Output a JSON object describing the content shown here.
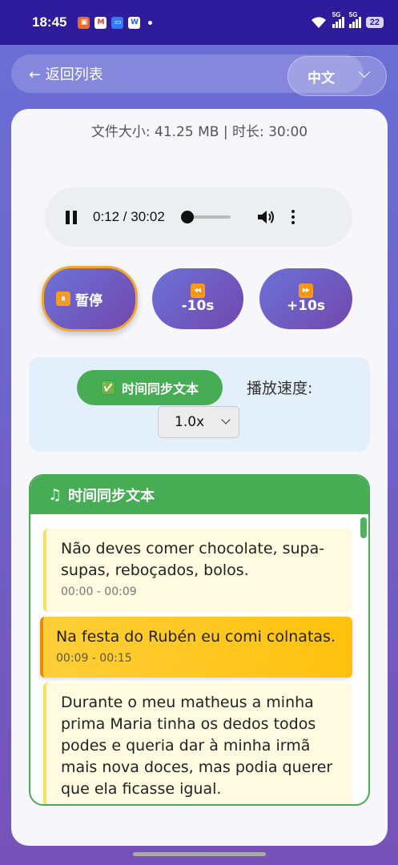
{
  "status": {
    "time": "18:45",
    "battery": "22",
    "net1": "5G",
    "net2": "5G"
  },
  "header": {
    "back_label": "← 返回列表",
    "language": "中文"
  },
  "file_info": "文件大小: 41.25 MB | 时长: 30:00",
  "player": {
    "time": "0:12 / 30:02",
    "progress": 0.007
  },
  "controls": {
    "pause_emoji": "⏸",
    "pause_label": "暂停",
    "back_emoji": "⏪",
    "back_label": "-10s",
    "fwd_emoji": "⏩",
    "fwd_label": "+10s"
  },
  "sync": {
    "button_check": "✅",
    "button_label": "时间同步文本",
    "speed_label": "播放速度:",
    "speed_value": "1.0x"
  },
  "transcript": {
    "title": "时间同步文本",
    "segments": [
      {
        "text": "Não deves comer chocolate, supa-supas, reboçados, bolos.",
        "time": "00:00 - 00:09"
      },
      {
        "text": "Na festa do Rubén eu comi colnatas.",
        "time": "00:09 - 00:15"
      },
      {
        "text": "Durante o meu matheus a minha prima Maria tinha os dedos todos podes e queria dar à minha irmã mais nova doces, mas podia querer que ela ficasse igual.",
        "time": ""
      }
    ]
  }
}
